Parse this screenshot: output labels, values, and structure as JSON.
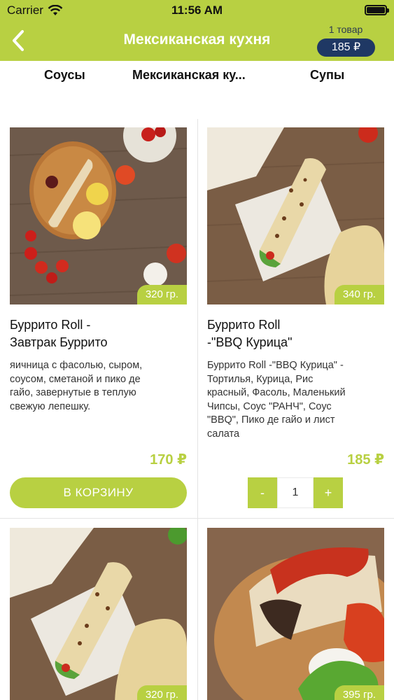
{
  "status_bar": {
    "carrier": "Carrier",
    "time": "11:56 AM"
  },
  "header": {
    "title": "Мексиканская кухня",
    "cart_count": "1 товар",
    "cart_total": "185 ₽"
  },
  "tabs": [
    {
      "label": "Соусы"
    },
    {
      "label": "Мексиканская ку..."
    },
    {
      "label": "Супы"
    }
  ],
  "products": [
    {
      "image": "breakfast-burrito-photo",
      "weight": "320 гр.",
      "name_line1": "Буррито Roll -",
      "name_line2": "Завтрак Буррито",
      "desc_lines": [
        "яичница с фасолью, сыром,",
        "соусом, сметаной и пико де",
        "гайо, завернутые в теплую",
        "свежую лепешку."
      ],
      "price": "170 ₽",
      "button_label": "В КОРЗИНУ"
    },
    {
      "image": "bbq-chicken-burrito-photo",
      "weight": "340 гр.",
      "name_line1": "Буррито Roll",
      "name_line2": "-\"BBQ Курица\"",
      "desc_lines": [
        "Буррито Roll -\"BBQ Курица\" -",
        "Тортилья, Курица, Рис",
        "красный, Фасоль, Маленький",
        "Чипсы, Соус \"РАНЧ\", Соус",
        "\"BBQ\", Пико де гайо и лист",
        "салата"
      ],
      "price": "185 ₽",
      "stepper": {
        "minus": "-",
        "quantity": "1",
        "plus": "+"
      }
    },
    {
      "image": "burrito-roll-photo",
      "weight": "320 гр."
    },
    {
      "image": "burrito-sauce-photo",
      "weight": "395 гр."
    }
  ]
}
